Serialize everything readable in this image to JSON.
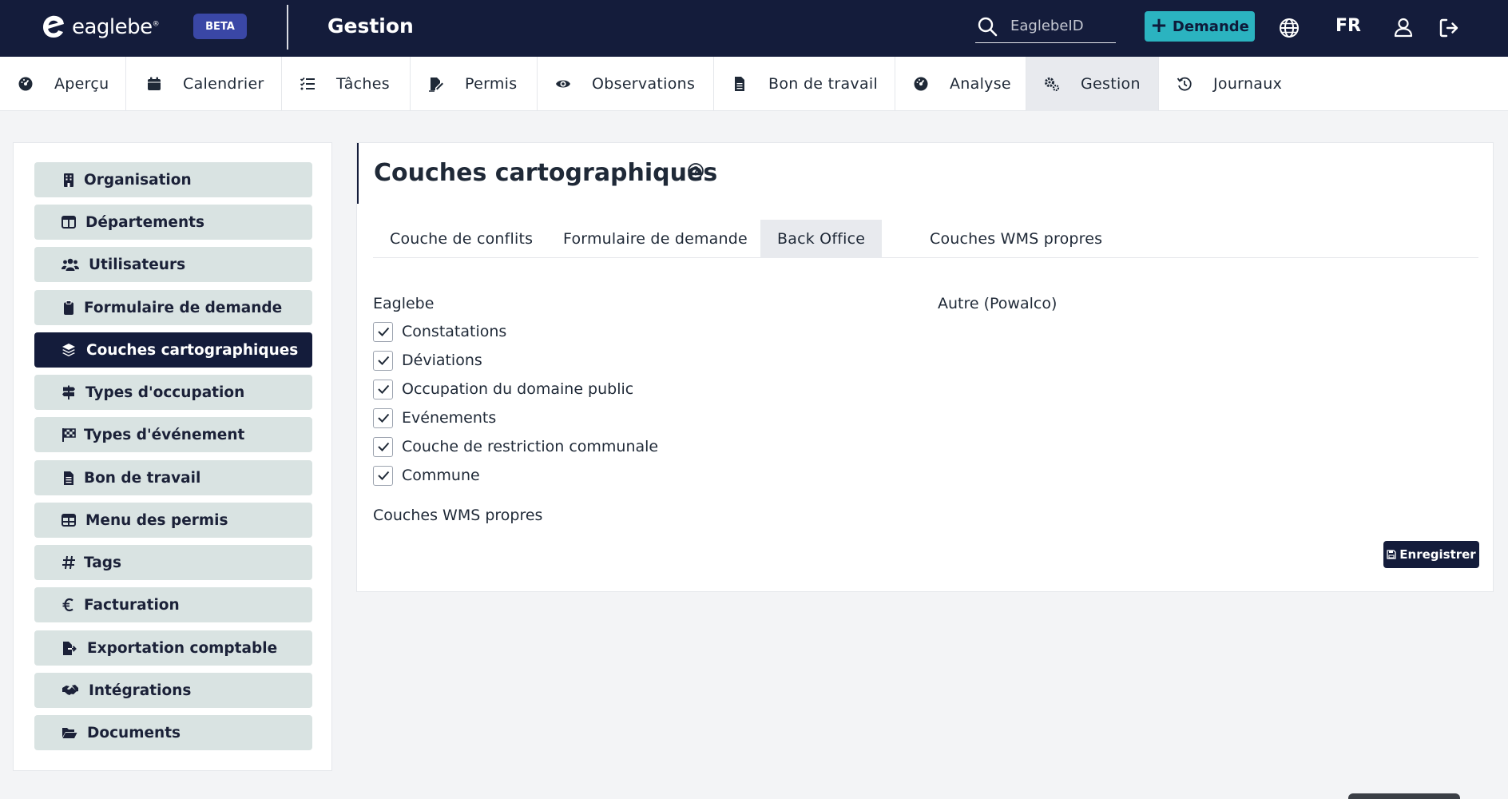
{
  "header": {
    "brand": "eaglebe",
    "brand_mark": "®",
    "beta": "BETA",
    "title": "Gestion",
    "search_placeholder": "EaglebeID",
    "demande_label": "Demande",
    "lang": "FR",
    "colors": {
      "bg": "#141c3b",
      "accent": "#2bb3c0",
      "beta": "#3a47a6"
    }
  },
  "nav": {
    "items": [
      {
        "label": "Aperçu",
        "icon": "gauge-icon"
      },
      {
        "label": "Calendrier",
        "icon": "calendar-icon"
      },
      {
        "label": "Tâches",
        "icon": "checklist-icon"
      },
      {
        "label": "Permis",
        "icon": "signature-icon"
      },
      {
        "label": "Observations",
        "icon": "eye-icon"
      },
      {
        "label": "Bon de travail",
        "icon": "file-icon"
      },
      {
        "label": "Analyse",
        "icon": "gauge-icon"
      },
      {
        "label": "Gestion",
        "icon": "gears-icon",
        "active": true
      },
      {
        "label": "Journaux",
        "icon": "history-icon"
      }
    ]
  },
  "sidebar": {
    "items": [
      {
        "label": "Organisation",
        "icon": "building-icon"
      },
      {
        "label": "Départements",
        "icon": "table-columns-icon"
      },
      {
        "label": "Utilisateurs",
        "icon": "users-icon"
      },
      {
        "label": "Formulaire de demande",
        "icon": "clipboard-icon"
      },
      {
        "label": "Couches cartographiques",
        "icon": "layer-group-icon",
        "active": true
      },
      {
        "label": "Types d'occupation",
        "icon": "signs-post-icon"
      },
      {
        "label": "Types d'événement",
        "icon": "flag-checkered-icon"
      },
      {
        "label": "Bon de travail",
        "icon": "file-lines-icon"
      },
      {
        "label": "Menu des permis",
        "icon": "table-icon"
      },
      {
        "label": "Tags",
        "icon": "hashtag-icon"
      },
      {
        "label": "Facturation",
        "icon": "euro-icon"
      },
      {
        "label": "Exportation comptable",
        "icon": "file-export-icon"
      },
      {
        "label": "Intégrations",
        "icon": "handshake-icon"
      },
      {
        "label": "Documents",
        "icon": "folder-open-icon"
      }
    ]
  },
  "main": {
    "title": "Couches cartographiques",
    "tabs": [
      {
        "label": "Couche de conflits"
      },
      {
        "label": "Formulaire de demande"
      },
      {
        "label": "Back Office",
        "active": true
      },
      {
        "label": "Couches WMS propres"
      }
    ],
    "left_column_title": "Eaglebe",
    "right_column_title": "Autre (Powalco)",
    "layers": [
      {
        "label": "Constatations",
        "checked": true
      },
      {
        "label": "Déviations",
        "checked": true
      },
      {
        "label": "Occupation du domaine public",
        "checked": true
      },
      {
        "label": "Evénements",
        "checked": true
      },
      {
        "label": "Couche de restriction communale",
        "checked": true
      },
      {
        "label": "Commune",
        "checked": true
      }
    ],
    "wms_section_title": "Couches WMS propres",
    "save_label": "Enregistrer"
  }
}
